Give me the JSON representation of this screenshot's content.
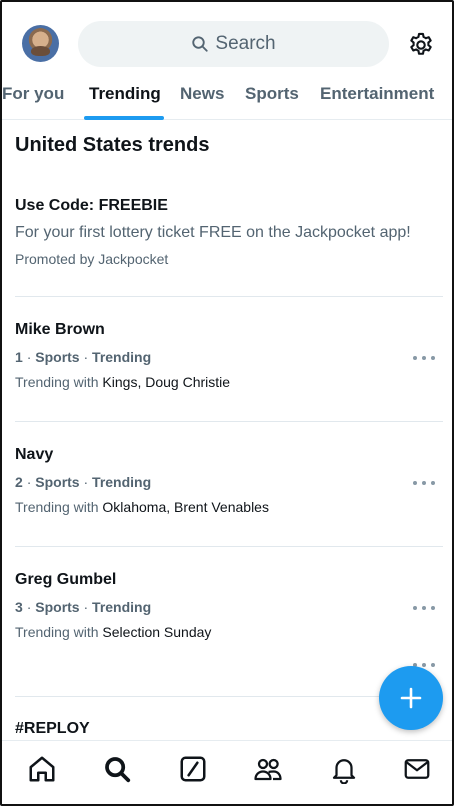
{
  "header": {
    "search_placeholder": "Search"
  },
  "tabs": [
    {
      "label": "For you"
    },
    {
      "label": "Trending"
    },
    {
      "label": "News"
    },
    {
      "label": "Sports"
    },
    {
      "label": "Entertainment"
    }
  ],
  "section_title": "United States trends",
  "promo": {
    "title": "Use Code: FREEBIE",
    "text": "For your first lottery ticket FREE on the Jackpocket app!",
    "promoted_by": "Promoted by Jackpocket"
  },
  "trends": [
    {
      "name": "Mike Brown",
      "rank": "1",
      "category": "Sports",
      "status": "Trending",
      "with_label": "Trending with",
      "with_names": "Kings, Doug Christie"
    },
    {
      "name": "Navy",
      "rank": "2",
      "category": "Sports",
      "status": "Trending",
      "with_label": "Trending with",
      "with_names": "Oklahoma, Brent Venables"
    },
    {
      "name": "Greg Gumbel",
      "rank": "3",
      "category": "Sports",
      "status": "Trending",
      "with_label": "Trending with",
      "with_names": "Selection Sunday"
    },
    {
      "name": "#REPLOY"
    }
  ],
  "separator": "·",
  "bottom_nav": [
    {
      "icon": "home-icon"
    },
    {
      "icon": "search-icon"
    },
    {
      "icon": "grok-icon"
    },
    {
      "icon": "communities-icon"
    },
    {
      "icon": "notifications-icon"
    },
    {
      "icon": "messages-icon"
    }
  ],
  "colors": {
    "accent": "#1d9bf0",
    "text_primary": "#0f1419",
    "text_secondary": "#536471"
  }
}
